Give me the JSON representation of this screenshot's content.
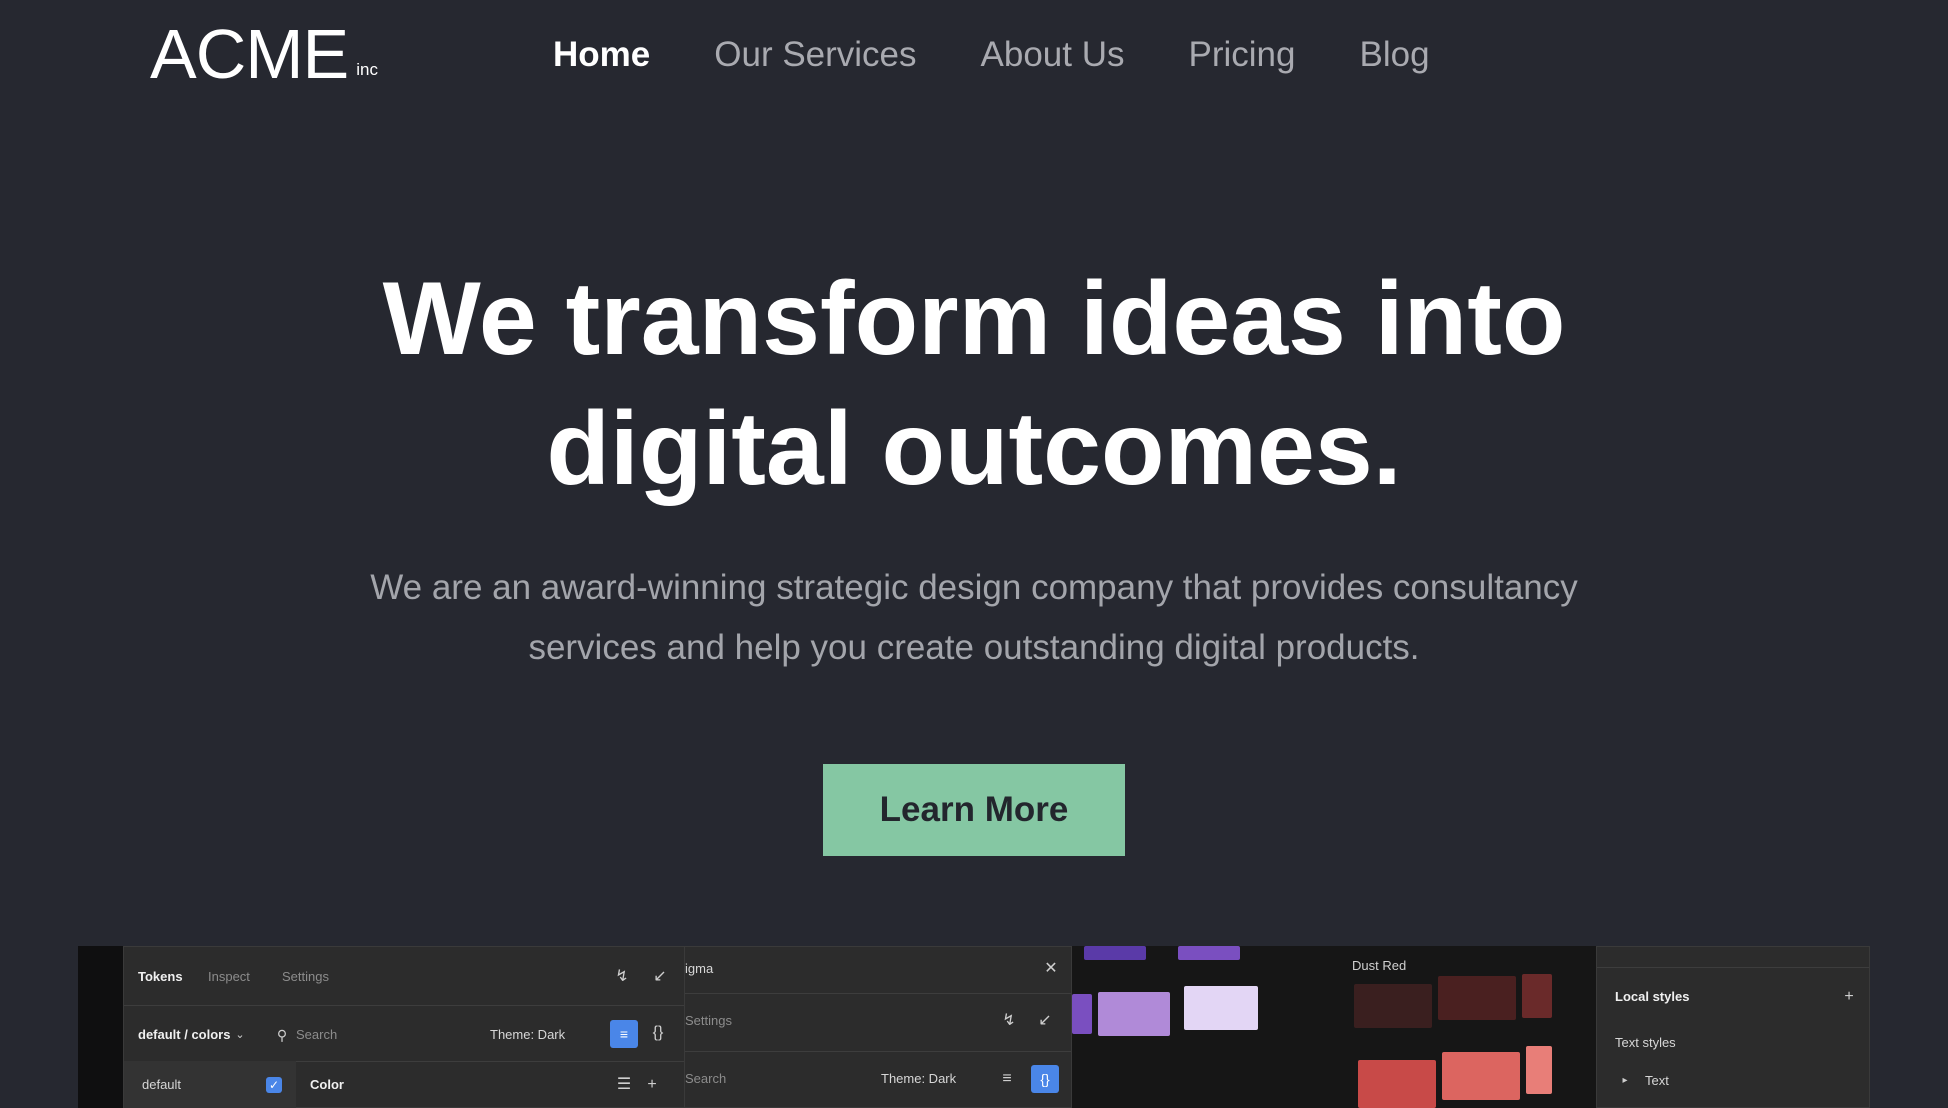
{
  "header": {
    "logo": "ACME",
    "logo_suffix": "inc",
    "nav": [
      {
        "label": "Home",
        "active": true
      },
      {
        "label": "Our Services"
      },
      {
        "label": "About Us"
      },
      {
        "label": "Pricing"
      },
      {
        "label": "Blog"
      }
    ]
  },
  "hero": {
    "title_line1": "We transform ideas into",
    "title_line2": "digital outcomes.",
    "subtitle_line1": "We are an award-winning strategic design company that provides consultancy",
    "subtitle_line2": "services and help you create outstanding digital products.",
    "cta_label": "Learn More"
  },
  "preview": {
    "plugin": {
      "tabs": [
        "Tokens",
        "Inspect",
        "Settings"
      ],
      "set_path": "default / colors",
      "search_placeholder": "Search",
      "theme": "Theme: Dark",
      "set_name": "default",
      "group": "Color"
    },
    "plugin2": {
      "title": "igma",
      "tab": "Settings",
      "search_placeholder": "Search",
      "theme": "Theme: Dark"
    },
    "palette": {
      "title": "Dust Red",
      "purple_colors": [
        "#5a3aa8",
        "#7a4fc0",
        "#9a6ad0",
        "#c0a0e6",
        "#e3d6f5"
      ],
      "red_colors": [
        "#3a1f1f",
        "#4a2020",
        "#6a2a2a",
        "#c84a48",
        "#dc6560",
        "#e87e78"
      ]
    },
    "styles": {
      "title": "Local styles",
      "section": "Text styles",
      "item": "Text"
    },
    "accent_color": "#4a86e8"
  },
  "colors": {
    "background": "#262830",
    "cta": "#85c7a3"
  }
}
